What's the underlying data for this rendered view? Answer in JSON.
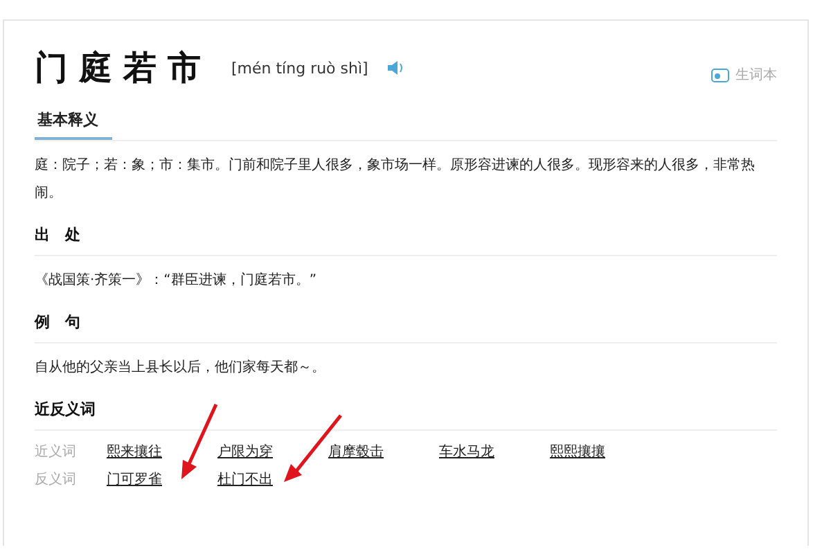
{
  "header": {
    "title": "门庭若市",
    "pinyin": "[mén tíng ruò shì]",
    "wordbook": "生词本"
  },
  "tabs": [
    {
      "label": "基本释义",
      "selected": true
    }
  ],
  "definition": "庭：院子；若：象；市：集市。门前和院子里人很多，象市场一样。原形容进谏的人很多。现形容来的人很多，非常热闹。",
  "source": {
    "heading": "出　处",
    "text": "《战国策·齐策一》：“群臣进谏，门庭若市。”"
  },
  "example": {
    "heading": "例　句",
    "text": "自从他的父亲当上县长以后，他们家每天都～。"
  },
  "related": {
    "heading": "近反义词",
    "rows": [
      {
        "label": "近义词",
        "words": [
          "熙来攘往",
          "户限为穿",
          "肩摩毂击",
          "车水马龙",
          "熙熙攘攘"
        ]
      },
      {
        "label": "反义词",
        "words": [
          "门可罗雀",
          "杜门不出"
        ]
      }
    ]
  }
}
